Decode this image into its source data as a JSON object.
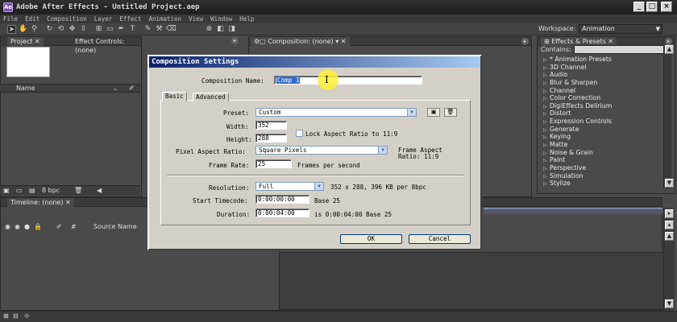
{
  "window": {
    "title": "Adobe After Effects - Untitled Project.aep",
    "app_icon": "Ae"
  },
  "menu": [
    "File",
    "Edit",
    "Composition",
    "Layer",
    "Effect",
    "Animation",
    "View",
    "Window",
    "Help"
  ],
  "toolbar": {
    "workspace_label": "Workspace:",
    "workspace_value": "Animation"
  },
  "panels": {
    "project_tab": "Project",
    "effect_controls_tab": "Effect Controls: (none)",
    "composition_tab": "Composition: (none)",
    "effects_presets_tab": "Effects & Presets",
    "name_column": "Name",
    "bpc": "8 bpc",
    "timeline_tab": "Timeline: (none)",
    "source_name_column": "Source Name",
    "hash_column": "#"
  },
  "effects": {
    "contains_label": "Contains:",
    "items": [
      "* Animation Presets",
      "3D Channel",
      "Audio",
      "Blur & Sharpen",
      "Channel",
      "Color Correction",
      "DigiEffects Delirium",
      "Distort",
      "Expression Controls",
      "Generate",
      "Keying",
      "Matte",
      "Noise & Grain",
      "Paint",
      "Perspective",
      "Simulation",
      "Stylize"
    ]
  },
  "dialog": {
    "title": "Composition Settings",
    "comp_name_label": "Composition Name:",
    "comp_name_value": "Comp 1",
    "tab_basic": "Basic",
    "tab_advanced": "Advanced",
    "preset_label": "Preset:",
    "preset_value": "Custom",
    "width_label": "Width:",
    "width_value": "352",
    "height_label": "Height:",
    "height_value": "288",
    "lock_aspect_label": "Lock Aspect Ratio to 11:9",
    "pixel_aspect_label": "Pixel Aspect Ratio:",
    "pixel_aspect_value": "Square Pixels",
    "frame_aspect_line1": "Frame Aspect",
    "frame_aspect_line2": "Ratio: 11:9",
    "frame_rate_label": "Frame Rate:",
    "frame_rate_value": "25",
    "frame_rate_unit": "Frames per second",
    "resolution_label": "Resolution:",
    "resolution_value": "Full",
    "resolution_info": "352 x 288, 396 KB per 8bpc",
    "start_tc_label": "Start Timecode:",
    "start_tc_value": "0:00:00:00",
    "start_tc_base": "Base 25",
    "duration_label": "Duration:",
    "duration_value": "0:00:04:00",
    "duration_info": "is 0:00:04:00  Base 25",
    "ok": "OK",
    "cancel": "Cancel"
  }
}
